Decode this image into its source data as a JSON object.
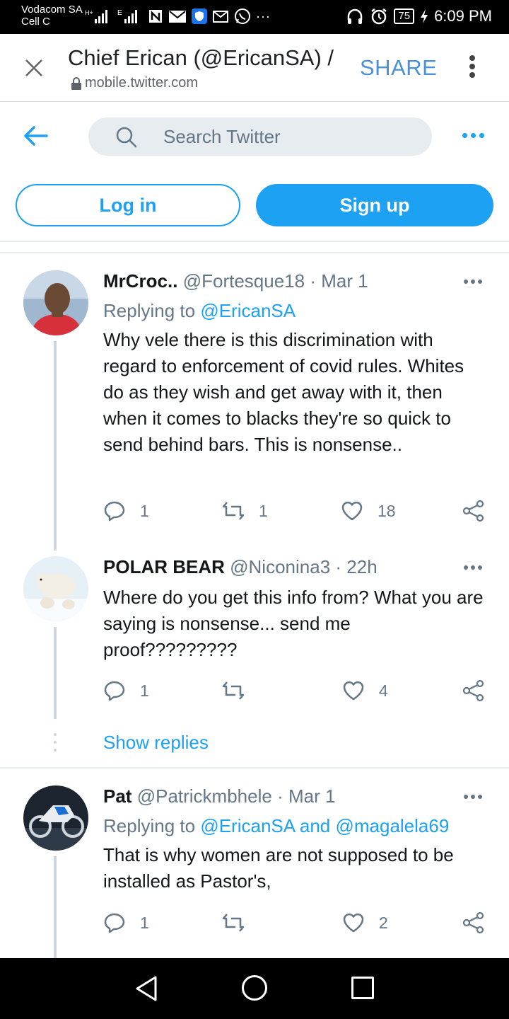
{
  "status_bar": {
    "carrier": "Vodacom SA",
    "carrier_sub": "Cell C",
    "battery": "75",
    "time": "6:09 PM"
  },
  "browser": {
    "title": "Chief Erican (@EricanSA) /",
    "url": "mobile.twitter.com",
    "share_label": "SHARE"
  },
  "twitter": {
    "search_placeholder": "Search Twitter",
    "login_label": "Log in",
    "signup_label": "Sign up",
    "accent": "#1da1f2"
  },
  "tweets": [
    {
      "name": "MrCroc..",
      "handle": "@Fortesque18",
      "date": "· Mar 1",
      "replying_prefix": "Replying to",
      "replying_to": "@EricanSA",
      "text": "Why vele there is this discrimination with regard to enforcement of covid rules. Whites do as they wish and get away with it, then when it comes to blacks they're so quick to send behind bars. This is nonsense..",
      "replies": "1",
      "retweets": "1",
      "likes": "18"
    },
    {
      "name": "POLAR BEAR",
      "handle": "@Niconina3",
      "date": "· 22h",
      "text": "Where do you get this info from? What you are saying is nonsense... send me proof?????????",
      "replies": "1",
      "retweets": "",
      "likes": "4"
    },
    {
      "name": "Pat",
      "handle": "@Patrickmbhele",
      "date": "· Mar 1",
      "replying_prefix": "Replying to",
      "replying_to": "@EricanSA and @magalela69",
      "text": "That is why women are not supposed to be installed as Pastor's,",
      "replies": "1",
      "retweets": "",
      "likes": "2"
    }
  ],
  "show_replies_label": "Show replies"
}
